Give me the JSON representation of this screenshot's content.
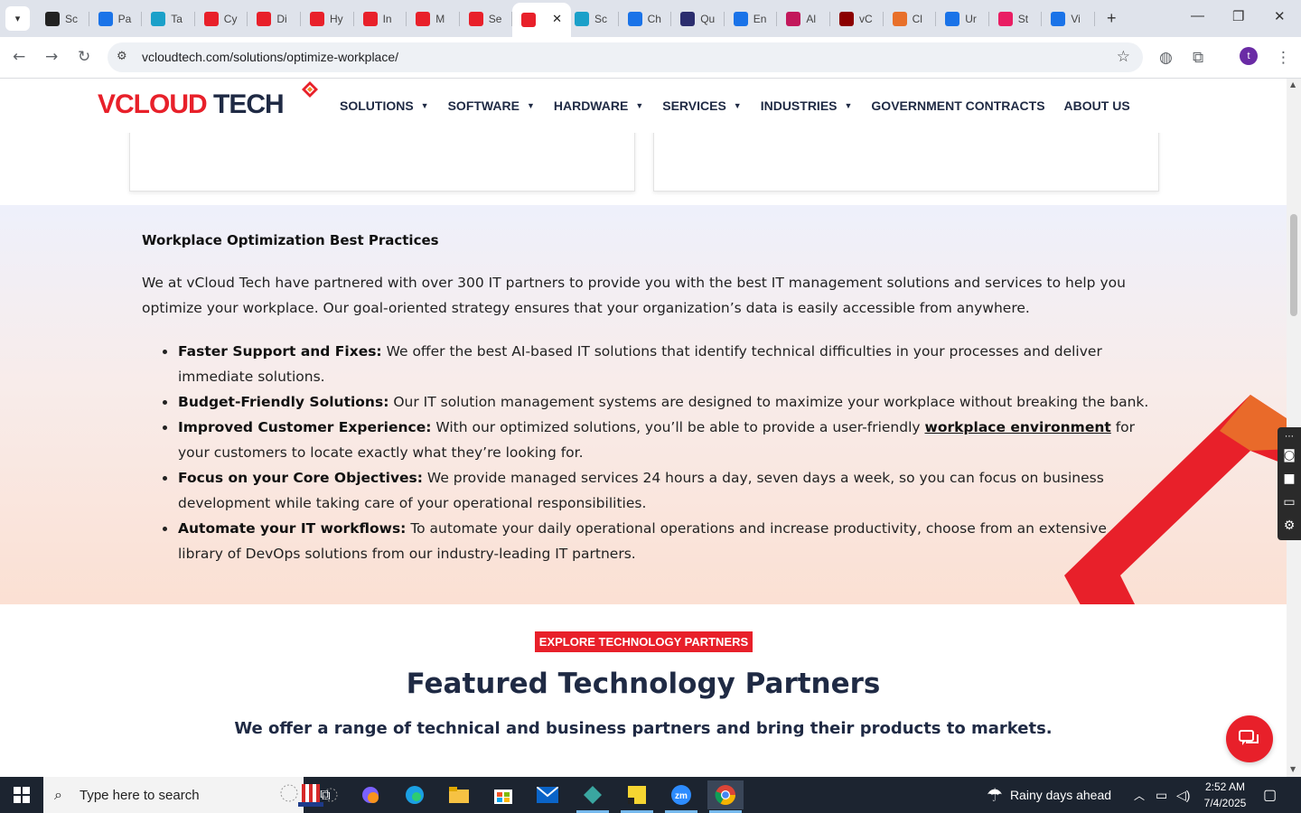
{
  "browser": {
    "tabs": [
      {
        "label": "Sc",
        "color": "#222222"
      },
      {
        "label": "Pa",
        "color": "#1a73e8"
      },
      {
        "label": "Ta",
        "color": "#1ba0c9"
      },
      {
        "label": "Cy",
        "color": "#e8202a"
      },
      {
        "label": "Di",
        "color": "#e8202a"
      },
      {
        "label": "Hy",
        "color": "#e8202a"
      },
      {
        "label": "In",
        "color": "#e8202a"
      },
      {
        "label": "M",
        "color": "#e8202a"
      },
      {
        "label": "Se",
        "color": "#e8202a"
      },
      {
        "label": "",
        "color": "#e8202a",
        "active": true
      },
      {
        "label": "Sc",
        "color": "#1ba0c9"
      },
      {
        "label": "Ch",
        "color": "#1a73e8"
      },
      {
        "label": "Qu",
        "color": "#2b2d6e"
      },
      {
        "label": "En",
        "color": "#1a73e8"
      },
      {
        "label": "Al",
        "color": "#c2185b"
      },
      {
        "label": "vC",
        "color": "#8b0000"
      },
      {
        "label": "Cl",
        "color": "#e8702a"
      },
      {
        "label": "Ur",
        "color": "#1a73e8"
      },
      {
        "label": "St",
        "color": "#e91e63"
      },
      {
        "label": "Vi",
        "color": "#1a73e8"
      }
    ],
    "url": "vcloudtech.com/solutions/optimize-workplace/",
    "profile_initial": "t"
  },
  "site": {
    "logo": {
      "v": "V",
      "cloud": "CLOUD",
      "tech": " TECH"
    },
    "nav": [
      {
        "label": "SOLUTIONS",
        "dropdown": true
      },
      {
        "label": "SOFTWARE",
        "dropdown": true
      },
      {
        "label": "HARDWARE",
        "dropdown": true
      },
      {
        "label": "SERVICES",
        "dropdown": true
      },
      {
        "label": "INDUSTRIES",
        "dropdown": true
      },
      {
        "label": "GOVERNMENT CONTRACTS",
        "dropdown": false
      },
      {
        "label": "ABOUT US",
        "dropdown": false
      }
    ]
  },
  "practices": {
    "heading": "Workplace Optimization Best Practices",
    "intro": "We at vCloud Tech have partnered with over 300 IT partners to provide you with the best IT management solutions and services to help you optimize your workplace. Our goal-oriented strategy ensures that your organization’s data is easily accessible from anywhere.",
    "items": [
      {
        "title": "Faster Support and Fixes:",
        "text": " We offer the best AI-based IT solutions that identify technical difficulties in your processes and deliver immediate solutions."
      },
      {
        "title": "Budget-Friendly Solutions:",
        "text": " Our IT solution management systems are designed to maximize your workplace without breaking the bank."
      },
      {
        "title": "Improved Customer Experience:",
        "text": " With our optimized solutions, you’ll be able to provide a user-friendly ",
        "link": "workplace environment",
        "text_after": " for your customers to locate exactly what they’re looking for."
      },
      {
        "title": "Focus on your Core Objectives:",
        "text": " We provide managed services 24 hours a day, seven days a week, so you can focus on business development while taking care of your operational responsibilities."
      },
      {
        "title": "Automate your IT workflows:",
        "text": " To automate your daily operational operations and increase productivity, choose from an extensive library of DevOps solutions from our industry-leading IT partners."
      }
    ]
  },
  "partners": {
    "button": "EXPLORE TECHNOLOGY PARTNERS",
    "title": "Featured Technology Partners",
    "subtitle": "We offer a range of technical and business partners and bring their products to markets."
  },
  "taskbar": {
    "search_placeholder": "Type here to search",
    "weather": "Rainy days ahead",
    "time": "2:52 AM",
    "date": "7/4/2025"
  },
  "colors": {
    "brand_red": "#e8202a",
    "brand_navy": "#1f2a44"
  }
}
